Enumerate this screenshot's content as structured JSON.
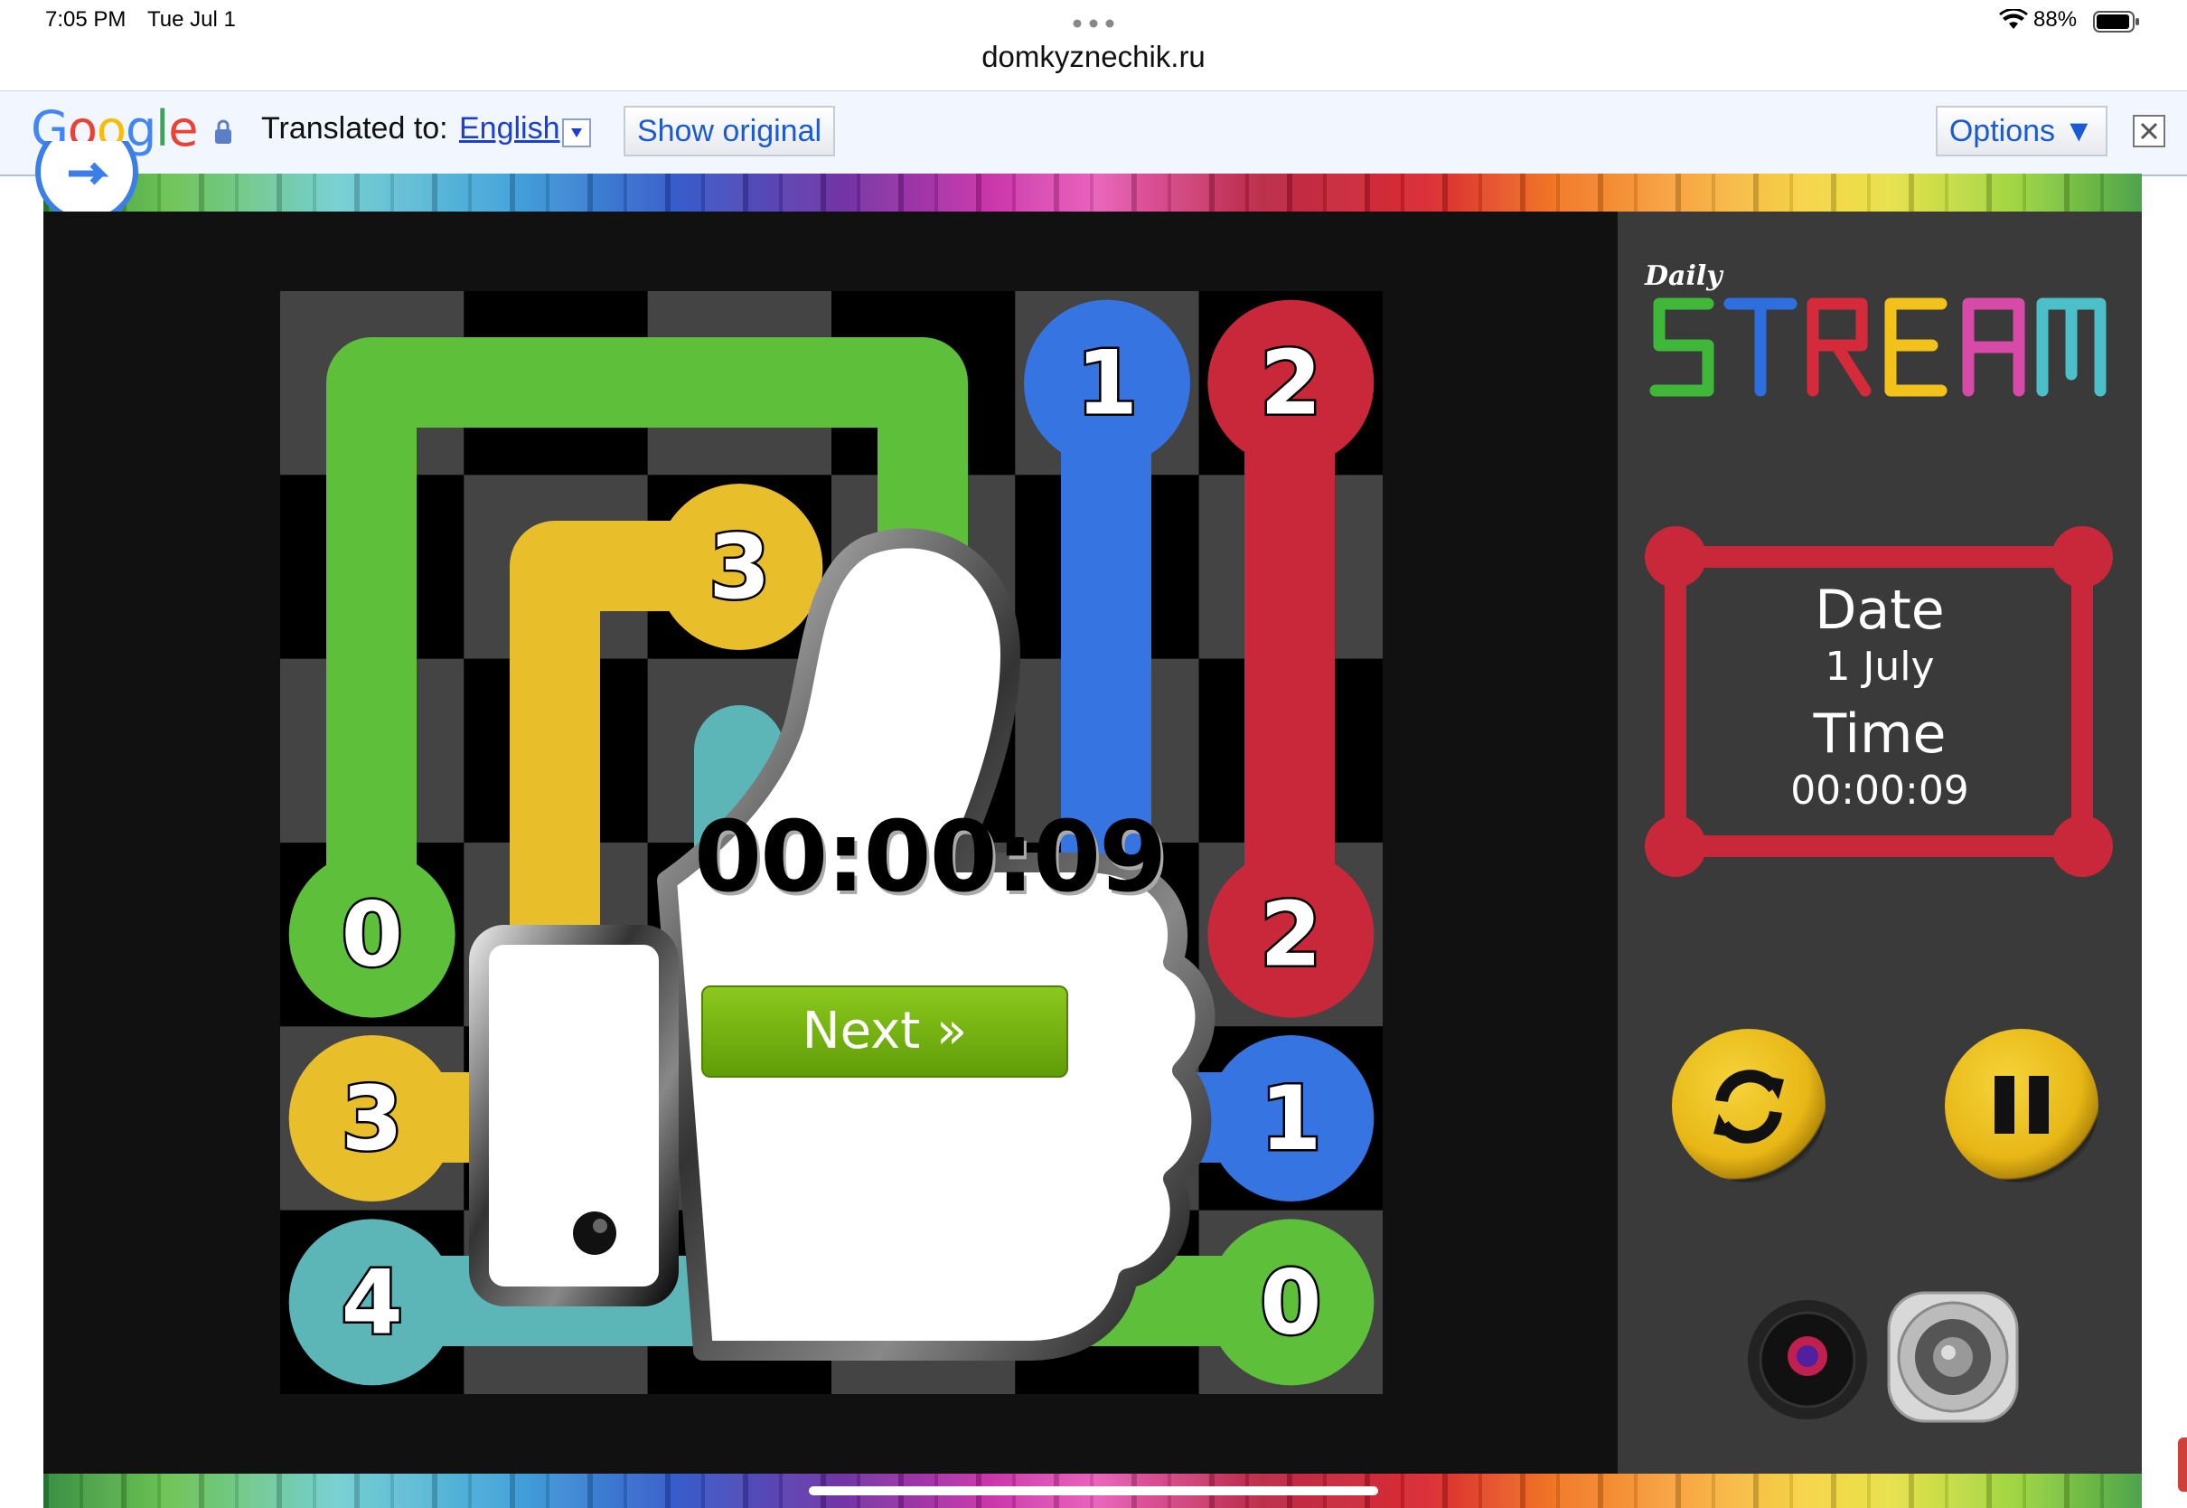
{
  "status_bar": {
    "time": "7:05 PM",
    "date": "Tue Jul 1",
    "battery": "88%",
    "url": "domkyznechik.ru"
  },
  "translate_bar": {
    "logo": "Google",
    "translated_to_label": "Translated to:",
    "language": "English",
    "show_original_label": "Show original",
    "options_label": "Options ▼",
    "close_icon": "close-icon"
  },
  "game": {
    "title_small": "Daily",
    "title_large": "STREAM",
    "title_colors": [
      "#3fb83a",
      "#2e6fe0",
      "#d42a3a",
      "#f2c21a",
      "#d84aa8",
      "#4cc0c8"
    ],
    "grid_size": 6,
    "endpoints": [
      {
        "label": "1",
        "color": "#3674e2",
        "col": 4,
        "row": 0
      },
      {
        "label": "2",
        "color": "#c8283a",
        "col": 5,
        "row": 0
      },
      {
        "label": "3",
        "color": "#e8be2a",
        "col": 2,
        "row": 1
      },
      {
        "label": "0",
        "color": "#5ebf3a",
        "col": 0,
        "row": 3
      },
      {
        "label": "2",
        "color": "#c8283a",
        "col": 5,
        "row": 3
      },
      {
        "label": "3",
        "color": "#e8be2a",
        "col": 0,
        "row": 4
      },
      {
        "label": "1",
        "color": "#3674e2",
        "col": 5,
        "row": 4
      },
      {
        "label": "4",
        "color": "#5cb6b8",
        "col": 0,
        "row": 5
      },
      {
        "label": "0",
        "color": "#5ebf3a",
        "col": 5,
        "row": 5
      }
    ],
    "result_time": "00:00:09",
    "next_label": "Next »",
    "info": {
      "date_label": "Date",
      "date_value": "1 July",
      "time_label": "Time",
      "time_value": "00:00:09"
    },
    "colors": {
      "board_light": "#444444",
      "board_dark": "#000000",
      "frame_red": "#c8283a"
    }
  }
}
